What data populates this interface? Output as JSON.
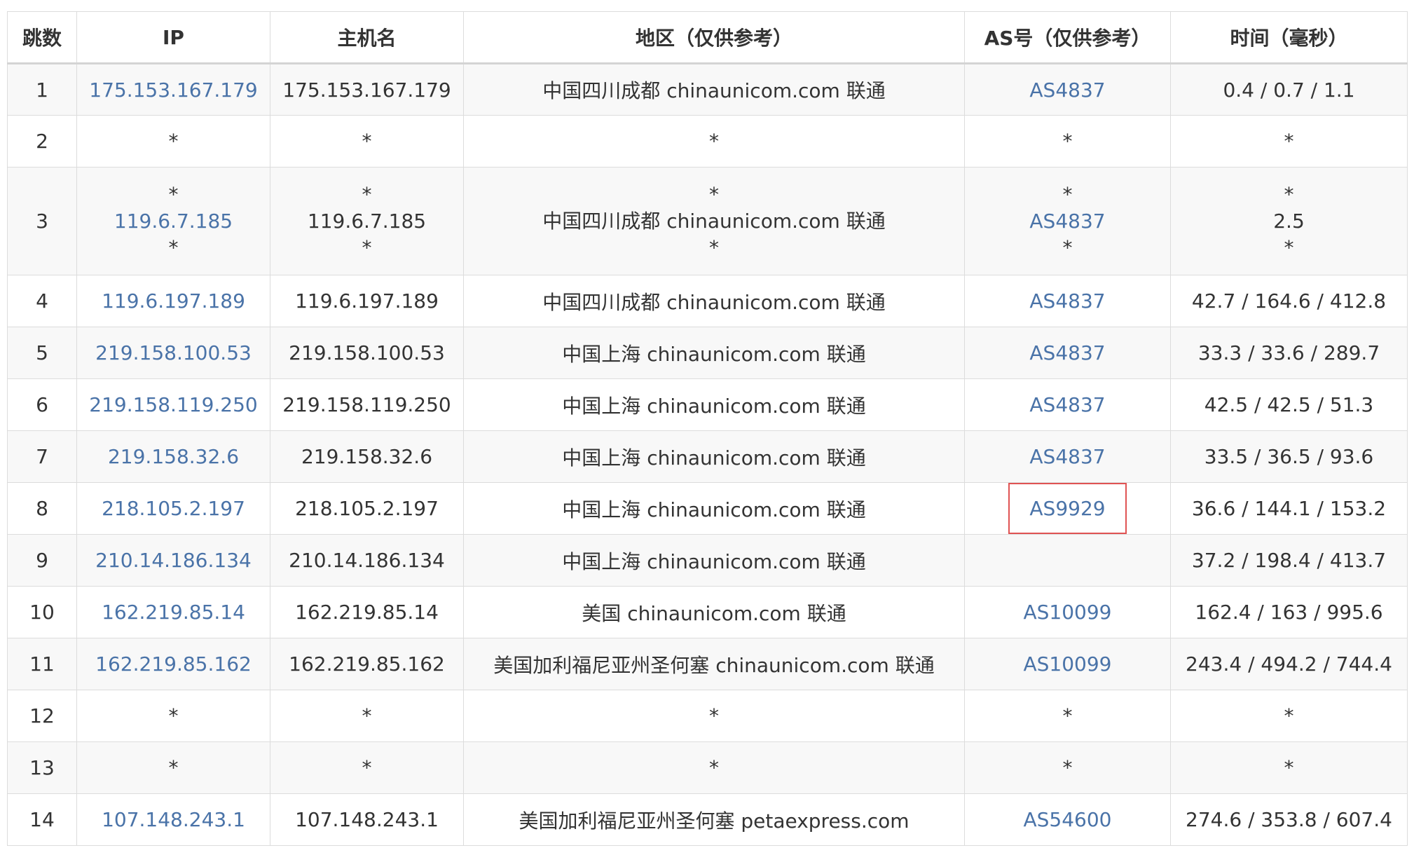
{
  "header": {
    "hop": "跳数",
    "ip": "IP",
    "hostname": "主机名",
    "region": "地区（仅供参考）",
    "as": "AS号（仅供参考）",
    "time": "时间（毫秒）"
  },
  "rows": [
    {
      "hop": "1",
      "ip": "175.153.167.179",
      "hostname": "175.153.167.179",
      "region": "中国四川成都 chinaunicom.com 联通",
      "as": "AS4837",
      "time": "0.4 / 0.7 / 1.1"
    },
    {
      "hop": "2",
      "ip": "*",
      "hostname": "*",
      "region": "*",
      "as": "*",
      "time": "*"
    },
    {
      "hop": "3",
      "ip": [
        "*",
        "119.6.7.185",
        "*"
      ],
      "hostname": [
        "*",
        "119.6.7.185",
        "*"
      ],
      "region": [
        "*",
        "中国四川成都 chinaunicom.com 联通",
        "*"
      ],
      "as": [
        "*",
        "AS4837",
        "*"
      ],
      "time": [
        "*",
        "2.5",
        "*"
      ]
    },
    {
      "hop": "4",
      "ip": "119.6.197.189",
      "hostname": "119.6.197.189",
      "region": "中国四川成都 chinaunicom.com 联通",
      "as": "AS4837",
      "time": "42.7 / 164.6 / 412.8"
    },
    {
      "hop": "5",
      "ip": "219.158.100.53",
      "hostname": "219.158.100.53",
      "region": "中国上海 chinaunicom.com 联通",
      "as": "AS4837",
      "time": "33.3 / 33.6 / 289.7"
    },
    {
      "hop": "6",
      "ip": "219.158.119.250",
      "hostname": "219.158.119.250",
      "region": "中国上海 chinaunicom.com 联通",
      "as": "AS4837",
      "time": "42.5 / 42.5 / 51.3"
    },
    {
      "hop": "7",
      "ip": "219.158.32.6",
      "hostname": "219.158.32.6",
      "region": "中国上海 chinaunicom.com 联通",
      "as": "AS4837",
      "time": "33.5 / 36.5 / 93.6"
    },
    {
      "hop": "8",
      "ip": "218.105.2.197",
      "hostname": "218.105.2.197",
      "region": "中国上海 chinaunicom.com 联通",
      "as": "AS9929",
      "time": "36.6 / 144.1 / 153.2"
    },
    {
      "hop": "9",
      "ip": "210.14.186.134",
      "hostname": "210.14.186.134",
      "region": "中国上海 chinaunicom.com 联通",
      "as": "",
      "time": "37.2 / 198.4 / 413.7"
    },
    {
      "hop": "10",
      "ip": "162.219.85.14",
      "hostname": "162.219.85.14",
      "region": "美国 chinaunicom.com 联通",
      "as": "AS10099",
      "time": "162.4 / 163 / 995.6"
    },
    {
      "hop": "11",
      "ip": "162.219.85.162",
      "hostname": "162.219.85.162",
      "region": "美国加利福尼亚州圣何塞 chinaunicom.com 联通",
      "as": "AS10099",
      "time": "243.4 / 494.2 / 744.4"
    },
    {
      "hop": "12",
      "ip": "*",
      "hostname": "*",
      "region": "*",
      "as": "*",
      "time": "*"
    },
    {
      "hop": "13",
      "ip": "*",
      "hostname": "*",
      "region": "*",
      "as": "*",
      "time": "*"
    },
    {
      "hop": "14",
      "ip": "107.148.243.1",
      "hostname": "107.148.243.1",
      "region": "美国加利福尼亚州圣何塞 petaexpress.com",
      "as": "AS54600",
      "time": "274.6 / 353.8 / 607.4"
    }
  ],
  "colors": {
    "link": "#4a73a8",
    "highlight_box": "#e05353",
    "row_alt": "#f8f8f8",
    "border": "#dcdcdc"
  }
}
